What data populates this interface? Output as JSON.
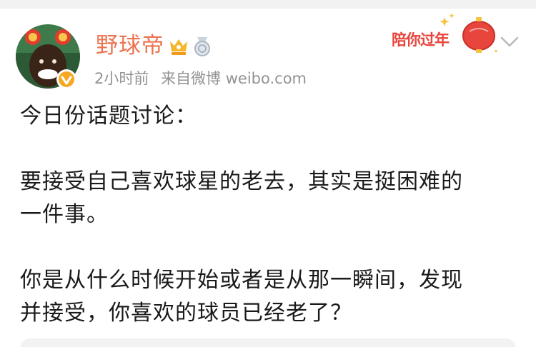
{
  "post": {
    "author": "野球帝",
    "time": "2小时前",
    "source": "来自微博 weibo.com",
    "promo_label": "陪你过年",
    "icons": {
      "avatar": "avatar",
      "verified": "verified-badge-icon",
      "vip": "vip-crown-icon",
      "medal": "medal-icon",
      "expand": "chevron-down-icon"
    },
    "body": {
      "line1": "今日份话题讨论：",
      "para2a": "要接受自己喜欢球星的老去，其实是挺困难的",
      "para2b": "一件事。",
      "para3a": "你是从什么时候开始或者是从那一瞬间，发现",
      "para3b": "并接受，你喜欢的球员已经老了？"
    }
  },
  "colors": {
    "username": "#eb7350",
    "meta": "#939393",
    "promo": "#e8453c",
    "text": "#1a1a1a"
  }
}
